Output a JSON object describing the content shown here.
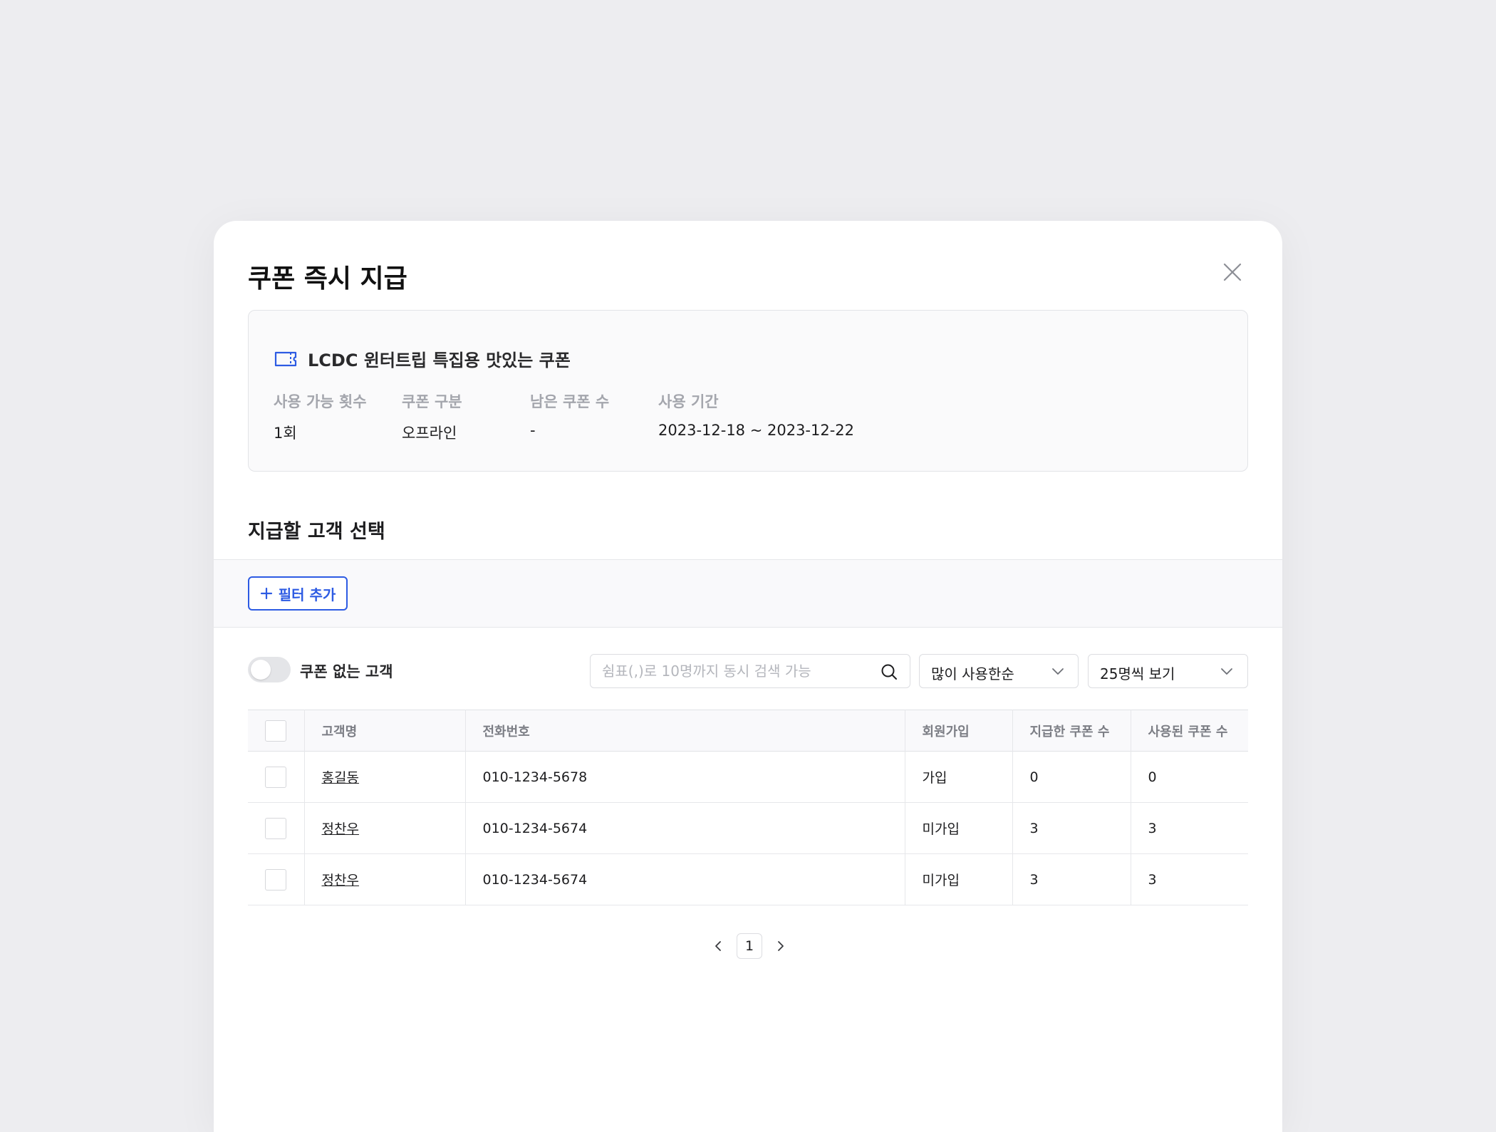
{
  "modal": {
    "title": "쿠폰 즉시 지급"
  },
  "coupon": {
    "icon": "ticket-icon",
    "name": "LCDC 윈터트립 특집용 맛있는 쿠폰",
    "meta": [
      {
        "label": "사용 가능 횟수",
        "value": "1회"
      },
      {
        "label": "쿠폰 구분",
        "value": "오프라인"
      },
      {
        "label": "남은 쿠폰 수",
        "value": "-"
      },
      {
        "label": "사용 기간",
        "value": "2023-12-18 ~ 2023-12-22"
      }
    ]
  },
  "section": {
    "title": "지급할 고객 선택"
  },
  "filter": {
    "add_label": "필터 추가"
  },
  "toolbar": {
    "toggle_label": "쿠폰 없는 고객",
    "toggle_on": false,
    "search_placeholder": "쉼표(,)로 10명까지 동시 검색 가능",
    "sort_value": "많이 사용한순",
    "page_size_value": "25명씩 보기"
  },
  "table": {
    "headers": [
      "고객명",
      "전화번호",
      "회원가입",
      "지급한 쿠폰 수",
      "사용된 쿠폰 수"
    ],
    "rows": [
      [
        "홍길동",
        "010-1234-5678",
        "가입",
        "0",
        "0"
      ],
      [
        "정찬우",
        "010-1234-5674",
        "미가입",
        "3",
        "3"
      ],
      [
        "정찬우",
        "010-1234-5674",
        "미가입",
        "3",
        "3"
      ]
    ]
  },
  "pagination": {
    "current": "1"
  },
  "colors": {
    "accent": "#2d5be3",
    "background": "#ededf0"
  }
}
